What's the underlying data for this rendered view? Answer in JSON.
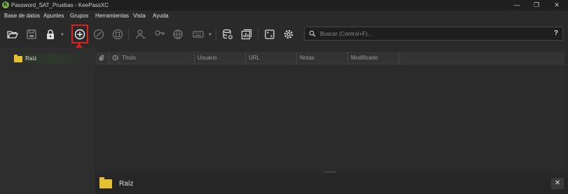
{
  "window": {
    "app_icon": "keepassxc-logo-icon",
    "title": "Password_SAT_Pruebas - KeePassXC",
    "controls": {
      "minimize": "—",
      "maximize": "❐",
      "close": "✕"
    }
  },
  "menubar": [
    "Base de datos",
    "Apuntes",
    "Grupos",
    "Herramientas",
    "Vista",
    "Ayuda"
  ],
  "toolbar": {
    "icons": [
      "open-database-icon",
      "save-database-icon",
      "lock-database-icon",
      "add-entry-icon",
      "edit-entry-icon",
      "delete-entry-icon",
      "copy-username-icon",
      "copy-password-icon",
      "open-url-icon",
      "autotype-icon",
      "database-settings-icon",
      "reports-icon",
      "password-generator-icon",
      "settings-icon"
    ],
    "highlight_color": "#e02020"
  },
  "search": {
    "placeholder": "Buscar (Control+F)...",
    "value": "",
    "help_label": "?"
  },
  "tree": {
    "root_label": "Raíz"
  },
  "table": {
    "columns": [
      "",
      "",
      "Título",
      "Usuario",
      "URL",
      "Notas",
      "Modificado"
    ],
    "rows": []
  },
  "preview": {
    "group_name": "Raíz",
    "close_label": "✕"
  },
  "colors": {
    "folder": "#e6c130",
    "accent_green": "#7fb24a",
    "background": "#2a2a2a"
  }
}
